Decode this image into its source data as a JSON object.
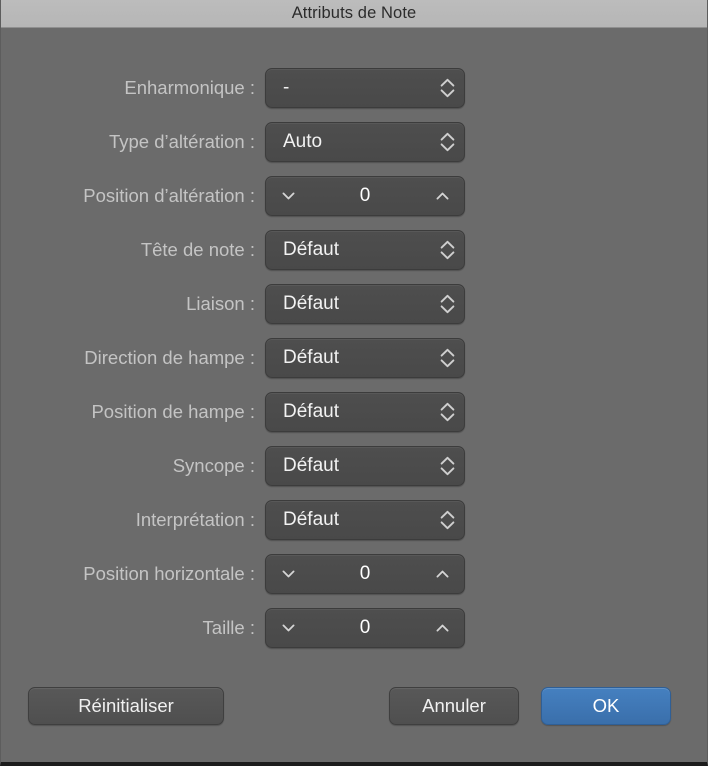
{
  "window": {
    "title": "Attributs de Note"
  },
  "form": {
    "rows": [
      {
        "label": "Enharmonique :",
        "type": "popup",
        "value": "-"
      },
      {
        "label": "Type d’altération :",
        "type": "popup",
        "value": "Auto"
      },
      {
        "label": "Position d’altération :",
        "type": "stepper",
        "value": "0"
      },
      {
        "label": "Tête de note :",
        "type": "popup",
        "value": "Défaut"
      },
      {
        "label": "Liaison :",
        "type": "popup",
        "value": "Défaut"
      },
      {
        "label": "Direction de hampe :",
        "type": "popup",
        "value": "Défaut"
      },
      {
        "label": "Position de hampe :",
        "type": "popup",
        "value": "Défaut"
      },
      {
        "label": "Syncope :",
        "type": "popup",
        "value": "Défaut"
      },
      {
        "label": "Interprétation :",
        "type": "popup",
        "value": "Défaut"
      },
      {
        "label": "Position horizontale :",
        "type": "stepper",
        "value": "0"
      },
      {
        "label": "Taille :",
        "type": "stepper",
        "value": "0"
      }
    ]
  },
  "footer": {
    "reset_label": "Réinitialiser",
    "cancel_label": "Annuler",
    "ok_label": "OK"
  },
  "colors": {
    "titlebar": "#b8b8b8",
    "window_background": "#6b6b6b",
    "control_background": "#4b4b4b",
    "label_text": "#c4c4c4",
    "value_text": "#f2f2f2",
    "accent_ok": "#3e78b5"
  }
}
